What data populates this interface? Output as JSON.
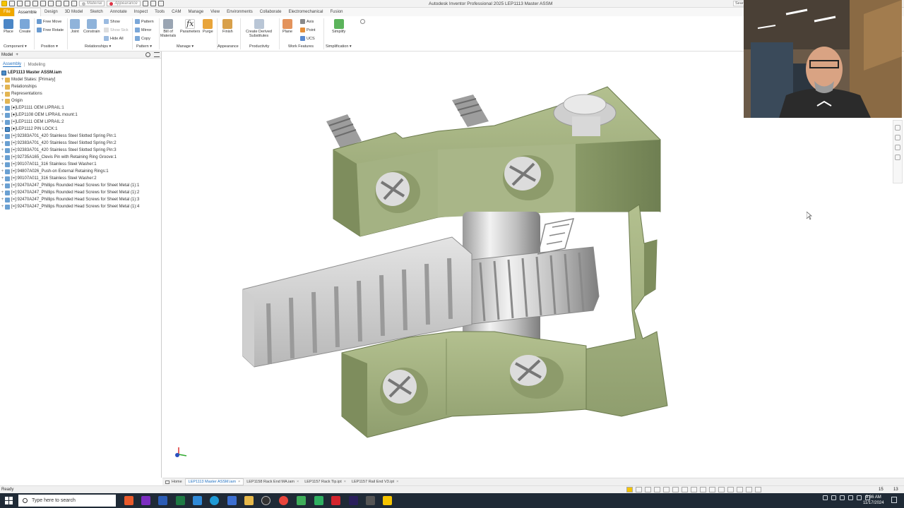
{
  "app": {
    "title": "Autodesk Inventor Professional 2025   LEP1113 Master ASSM",
    "search_label": "Search"
  },
  "quick_access": {
    "material_value": "Material",
    "appearance_value": "Appearance"
  },
  "tabs": [
    "File",
    "Assemble",
    "Design",
    "3D Model",
    "Sketch",
    "Annotate",
    "Inspect",
    "Tools",
    "CAM",
    "Manage",
    "View",
    "Environments",
    "Collaborate",
    "Electromechanical",
    "Fusion"
  ],
  "active_tab": "Assemble",
  "ribbon": {
    "place": "Place",
    "create": "Create",
    "free_move": "Free Move",
    "free_rotate": "Free Rotate",
    "joint": "Joint",
    "constrain": "Constrain",
    "show": "Show",
    "show_sick": "Show Sick",
    "hide_all": "Hide All",
    "pattern": "Pattern",
    "mirror": "Mirror",
    "copy": "Copy",
    "bom_line1": "Bill of",
    "bom_line2": "Materials",
    "parameters": "Parameters",
    "purge": "Purge",
    "finish": "Finish",
    "derived_line1": "Create Derived",
    "derived_line2": "Substitutes",
    "plane": "Plane",
    "axis": "Axis",
    "point": "Point",
    "ucs": "UCS",
    "simplify": "Simplify",
    "groups": {
      "component": "Component ▾",
      "position": "Position ▾",
      "relationships": "Relationships ▾",
      "pattern": "Pattern ▾",
      "manage": "Manage ▾",
      "appearance": "Appearance",
      "productivity": "Productivity",
      "work_features": "Work Features",
      "simplification": "Simplification ▾"
    }
  },
  "browser": {
    "header": "Model",
    "add": "+",
    "tab_assembly": "Assembly",
    "tab_modeling": "Modeling",
    "root": "LEP1113 Master ASSM.iam",
    "nodes": [
      {
        "label": "Model States: [Primary]",
        "kind": "fold"
      },
      {
        "label": "Relationships",
        "kind": "fold"
      },
      {
        "label": "Representations",
        "kind": "fold"
      },
      {
        "label": "Origin",
        "kind": "fold"
      },
      {
        "label": "[●]LEP1111 OEM LIPRAIL:1",
        "kind": "part"
      },
      {
        "label": "[●]LEP1108 OEM LIPRAIL mount:1",
        "kind": "part"
      },
      {
        "label": "[=]LEP1111 OEM LIPRAIL:2",
        "kind": "part"
      },
      {
        "label": "[●]LEP1112 PIN LOCK:1",
        "kind": "asm"
      },
      {
        "label": "[=]:92383A701_420 Stainless Steel Slotted Spring Pin:1",
        "kind": "part"
      },
      {
        "label": "[=]:92383A701_420 Stainless Steel Slotted Spring Pin:2",
        "kind": "part"
      },
      {
        "label": "[=]:92383A701_420 Stainless Steel Slotted Spring Pin:3",
        "kind": "part"
      },
      {
        "label": "[=]:92735A165_Clevis Pin with Retaining Ring Groove:1",
        "kind": "part"
      },
      {
        "label": "[=]:90107A011_316 Stainless Steel Washer:1",
        "kind": "part"
      },
      {
        "label": "[=]:94807A026_Push-on External Retaining Rings:1",
        "kind": "part"
      },
      {
        "label": "[=]:90107A011_316 Stainless Steel Washer:2",
        "kind": "part"
      },
      {
        "label": "[=]:92470A247_Phillips Rounded Head Screws for Sheet Metal (1):1",
        "kind": "part"
      },
      {
        "label": "[=]:92470A247_Phillips Rounded Head Screws for Sheet Metal (1):2",
        "kind": "part"
      },
      {
        "label": "[=]:92470A247_Phillips Rounded Head Screws for Sheet Metal (1):3",
        "kind": "part"
      },
      {
        "label": "[=]:92470A247_Phillips Rounded Head Screws for Sheet Metal (1):4",
        "kind": "part"
      }
    ]
  },
  "doc_tabs": {
    "home": "Home",
    "items": [
      "LEP1113 Master ASSM.iam",
      "LEP1158 Rack End MA.iam",
      "LEP1157 Rack Tip.ipt",
      "LEP1157 Rail End V3.ipt"
    ],
    "close": "×"
  },
  "status": {
    "text": "Ready",
    "num1": "15",
    "num2": "13"
  },
  "taskbar": {
    "search_placeholder": "Type here to search",
    "time": "9:36 AM",
    "date": "11/17/2024"
  },
  "colors": {
    "part_green": "#a6b486",
    "rack_gray": "#cfcfcf",
    "accent_blue": "#1e6fc0",
    "file_tab": "#f0a800"
  }
}
